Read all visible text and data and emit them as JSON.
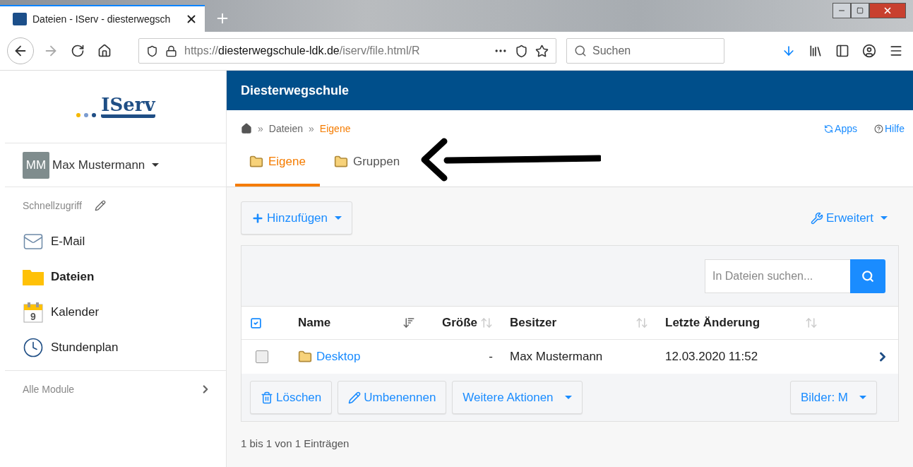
{
  "browser": {
    "tab_title": "Dateien - IServ - diesterwegsch",
    "url": {
      "scheme": "https://",
      "host": "diesterwegschule-ldk.de",
      "path": "/iserv/file.html/R"
    },
    "search_placeholder": "Suchen"
  },
  "sidebar": {
    "logo": "IServ",
    "user": {
      "initials": "MM",
      "name": "Max Mustermann"
    },
    "quick_access": "Schnellzugriff",
    "items": [
      {
        "label": "E-Mail",
        "kind": "mail",
        "selected": false
      },
      {
        "label": "Dateien",
        "kind": "files",
        "selected": true
      },
      {
        "label": "Kalender",
        "kind": "calendar",
        "selected": false,
        "day": "9"
      },
      {
        "label": "Stundenplan",
        "kind": "timetable",
        "selected": false
      }
    ],
    "all_modules": "Alle Module"
  },
  "header": {
    "title": "Diesterwegschule"
  },
  "breadcrumb": [
    "Dateien",
    "Eigene"
  ],
  "breadcrumb_separator": "»",
  "top_links": [
    {
      "label": "Apps",
      "kind": "apps"
    },
    {
      "label": "Hilfe",
      "kind": "help"
    }
  ],
  "tabs": [
    {
      "label": "Eigene",
      "selected": true
    },
    {
      "label": "Gruppen",
      "selected": false
    }
  ],
  "toolbar": {
    "add": "Hinzufügen",
    "advanced": "Erweitert"
  },
  "file_search": {
    "placeholder": "In Dateien suchen..."
  },
  "table": {
    "columns": [
      {
        "label": "Name",
        "sorted": true
      },
      {
        "label": "Größe",
        "sorted": false
      },
      {
        "label": "Besitzer",
        "sorted": false
      },
      {
        "label": "Letzte Änderung",
        "sorted": false
      }
    ],
    "rows": [
      {
        "name": "Desktop",
        "size": "-",
        "owner": "Max Mustermann",
        "modified": "12.03.2020 11:52",
        "checked": false
      }
    ]
  },
  "actions": [
    {
      "label": "Löschen",
      "kind": "delete"
    },
    {
      "label": "Umbenennen",
      "kind": "rename"
    },
    {
      "label": "Weitere Aktionen",
      "kind": "more"
    }
  ],
  "image_size": "Bilder: M",
  "footer": "1 bis 1 von 1 Einträgen"
}
